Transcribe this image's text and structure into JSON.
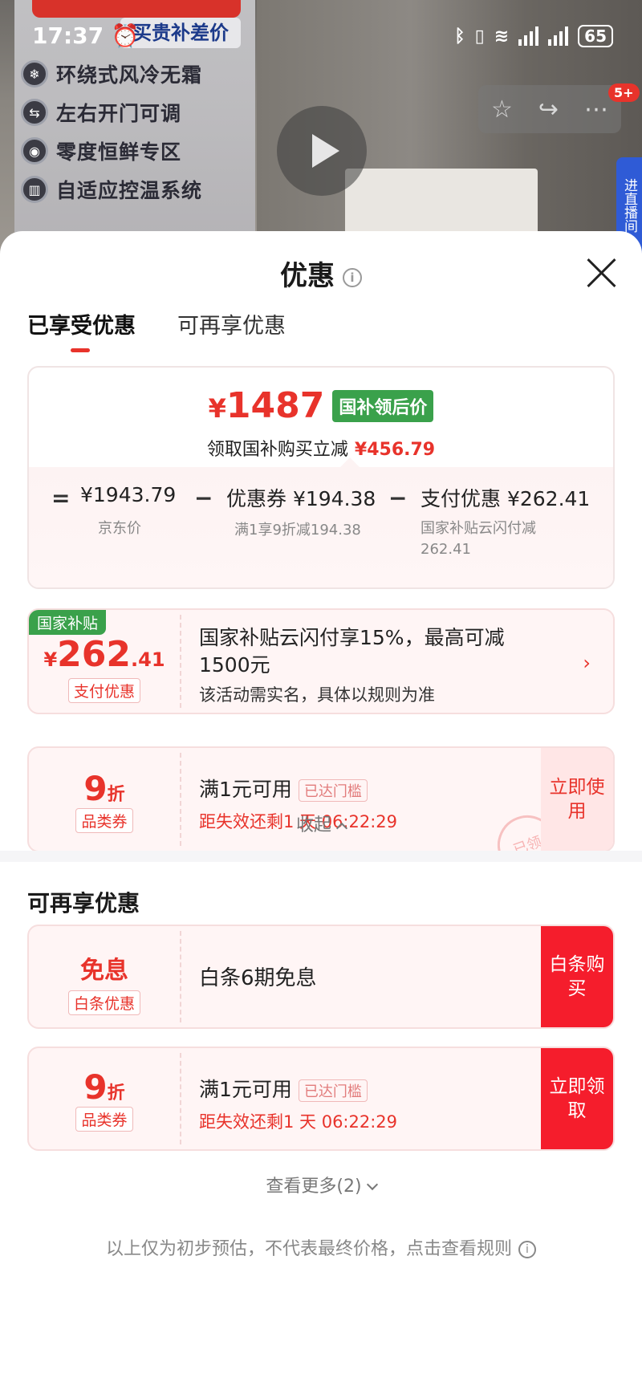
{
  "status_bar": {
    "time": "17:37",
    "battery": "65"
  },
  "video": {
    "buy_badge": "买贵补差价",
    "features": [
      "环绕式风冷无霜",
      "左右开门可调",
      "零度恒鲜专区",
      "自适应控温系统"
    ],
    "notification_count": "5+",
    "side_tab": "进直播间"
  },
  "sheet": {
    "title": "优惠"
  },
  "tabs": [
    {
      "label": "已享受优惠"
    },
    {
      "label": "可再享优惠"
    }
  ],
  "summary": {
    "final_price_symbol": "¥",
    "final_price": "1487",
    "price_tag": "国补领后价",
    "reduce_text": "领取国补购买立减",
    "reduce_amount": "¥456.79",
    "eq": "=",
    "minus": "−",
    "jd_price": "¥1943.79",
    "jd_price_label": "京东价",
    "coupon": "优惠券 ¥194.38",
    "coupon_label": "满1享9折减194.38",
    "pay": "支付优惠 ¥262.41",
    "pay_label_1": "国家补贴云闪付减",
    "pay_label_2": "262.41"
  },
  "enjoyed": {
    "subsidy": {
      "corner": "国家补贴",
      "symbol": "¥",
      "amount_int": "262",
      "amount_dec": ".41",
      "tag": "支付优惠",
      "title_1": "国家补贴云闪付享15%，最高可减",
      "title_2": "1500元",
      "desc": "该活动需实名，具体以规则为准"
    },
    "coupon": {
      "value": "9",
      "unit": "折",
      "tag": "品类券",
      "title": "满1元可用",
      "badge": "已达门槛",
      "expire": "距失效还剩1 天 06:22:29",
      "cta": "立即使用",
      "stamp": "已领"
    }
  },
  "collapse": "收起",
  "more_section": {
    "title": "可再享优惠",
    "items": [
      {
        "value": "免息",
        "tag": "白条优惠",
        "title": "白条6期免息",
        "cta": "白条购买"
      },
      {
        "value": "9",
        "unit": "折",
        "tag": "品类券",
        "title": "满1元可用",
        "badge": "已达门槛",
        "expire": "距失效还剩1 天 06:22:29",
        "cta": "立即领取"
      }
    ],
    "more_link": "查看更多(2)"
  },
  "disclaimer": "以上仅为初步预估，不代表最终价格，点击查看规则",
  "colors": {
    "accent": "#e8332b",
    "green": "#3aa14b",
    "cta": "#f51d2c"
  }
}
